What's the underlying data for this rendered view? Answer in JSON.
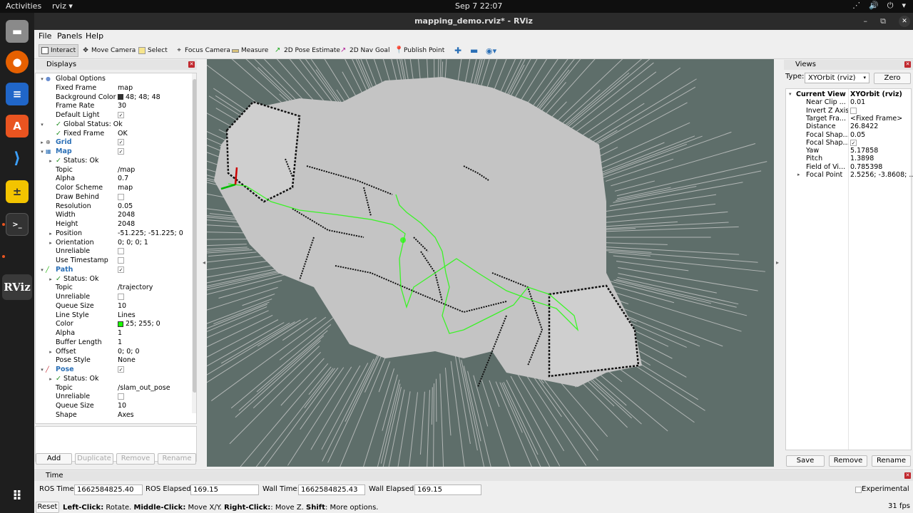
{
  "system": {
    "activities": "Activities",
    "app_name": "rviz ▾",
    "clock": "Sep 7  22:07",
    "tray": [
      "⋰",
      "🔊",
      "⏻",
      "▾"
    ]
  },
  "window": {
    "title": "mapping_demo.rviz* - RViz",
    "controls": [
      "–",
      "⧉",
      "✕"
    ]
  },
  "menu": [
    "File",
    "Panels",
    "Help"
  ],
  "toolbar": [
    {
      "label": "Interact",
      "icon": "interact-icon"
    },
    {
      "label": "Move Camera",
      "icon": "move-camera-icon"
    },
    {
      "label": "Select",
      "icon": "select-icon"
    },
    {
      "label": "Focus Camera",
      "icon": "focus-camera-icon"
    },
    {
      "label": "Measure",
      "icon": "measure-icon"
    },
    {
      "label": "2D Pose Estimate",
      "icon": "pose-estimate-icon"
    },
    {
      "label": "2D Nav Goal",
      "icon": "nav-goal-icon"
    },
    {
      "label": "Publish Point",
      "icon": "publish-point-icon"
    }
  ],
  "displays": {
    "title": "Displays",
    "rows": [
      {
        "d": 0,
        "exp": "▾",
        "label": "Global Options",
        "value": "",
        "type": "group"
      },
      {
        "d": 1,
        "exp": "",
        "label": "Fixed Frame",
        "value": "map"
      },
      {
        "d": 1,
        "exp": "",
        "label": "Background Color",
        "value": "48; 48; 48",
        "swatch": "#303030"
      },
      {
        "d": 1,
        "exp": "",
        "label": "Frame Rate",
        "value": "30"
      },
      {
        "d": 1,
        "exp": "",
        "label": "Default Light",
        "value": "",
        "chk": true
      },
      {
        "d": 0,
        "exp": "▾",
        "label": "Global Status: Ok",
        "value": "",
        "check": true
      },
      {
        "d": 1,
        "exp": "",
        "label": "Fixed Frame",
        "value": "OK",
        "check": true
      },
      {
        "d": 0,
        "exp": "▸",
        "label": "Grid",
        "value": "",
        "chk": true,
        "blue": true
      },
      {
        "d": 0,
        "exp": "▾",
        "label": "Map",
        "value": "",
        "chk": true,
        "blue": true
      },
      {
        "d": 1,
        "exp": "▸",
        "label": "Status: Ok",
        "value": "",
        "check": true
      },
      {
        "d": 1,
        "exp": "",
        "label": "Topic",
        "value": "/map"
      },
      {
        "d": 1,
        "exp": "",
        "label": "Alpha",
        "value": "0.7"
      },
      {
        "d": 1,
        "exp": "",
        "label": "Color Scheme",
        "value": "map"
      },
      {
        "d": 1,
        "exp": "",
        "label": "Draw Behind",
        "value": "",
        "chk": false
      },
      {
        "d": 1,
        "exp": "",
        "label": "Resolution",
        "value": "0.05"
      },
      {
        "d": 1,
        "exp": "",
        "label": "Width",
        "value": "2048"
      },
      {
        "d": 1,
        "exp": "",
        "label": "Height",
        "value": "2048"
      },
      {
        "d": 1,
        "exp": "▸",
        "label": "Position",
        "value": "-51.225; -51.225; 0"
      },
      {
        "d": 1,
        "exp": "▸",
        "label": "Orientation",
        "value": "0; 0; 0; 1"
      },
      {
        "d": 1,
        "exp": "",
        "label": "Unreliable",
        "value": "",
        "chk": false
      },
      {
        "d": 1,
        "exp": "",
        "label": "Use Timestamp",
        "value": "",
        "chk": false
      },
      {
        "d": 0,
        "exp": "▾",
        "label": "Path",
        "value": "",
        "chk": true,
        "blue": true
      },
      {
        "d": 1,
        "exp": "▸",
        "label": "Status: Ok",
        "value": "",
        "check": true
      },
      {
        "d": 1,
        "exp": "",
        "label": "Topic",
        "value": "/trajectory"
      },
      {
        "d": 1,
        "exp": "",
        "label": "Unreliable",
        "value": "",
        "chk": false
      },
      {
        "d": 1,
        "exp": "",
        "label": "Queue Size",
        "value": "10"
      },
      {
        "d": 1,
        "exp": "",
        "label": "Line Style",
        "value": "Lines"
      },
      {
        "d": 1,
        "exp": "",
        "label": "Color",
        "value": "25; 255; 0",
        "swatch": "#19ff00"
      },
      {
        "d": 1,
        "exp": "",
        "label": "Alpha",
        "value": "1"
      },
      {
        "d": 1,
        "exp": "",
        "label": "Buffer Length",
        "value": "1"
      },
      {
        "d": 1,
        "exp": "▸",
        "label": "Offset",
        "value": "0; 0; 0"
      },
      {
        "d": 1,
        "exp": "",
        "label": "Pose Style",
        "value": "None"
      },
      {
        "d": 0,
        "exp": "▾",
        "label": "Pose",
        "value": "",
        "chk": true,
        "blue": true
      },
      {
        "d": 1,
        "exp": "▸",
        "label": "Status: Ok",
        "value": "",
        "check": true
      },
      {
        "d": 1,
        "exp": "",
        "label": "Topic",
        "value": "/slam_out_pose"
      },
      {
        "d": 1,
        "exp": "",
        "label": "Unreliable",
        "value": "",
        "chk": false
      },
      {
        "d": 1,
        "exp": "",
        "label": "Queue Size",
        "value": "10"
      },
      {
        "d": 1,
        "exp": "",
        "label": "Shape",
        "value": "Axes"
      }
    ],
    "buttons": {
      "add": "Add",
      "duplicate": "Duplicate",
      "remove": "Remove",
      "rename": "Rename"
    }
  },
  "views": {
    "title": "Views",
    "type_label": "Type:",
    "type_value": "XYOrbit (rviz)",
    "zero_label": "Zero",
    "rows": [
      {
        "exp": "▾",
        "label": "Current View",
        "value": "XYOrbit (rviz)",
        "bold": true
      },
      {
        "exp": "",
        "label": "Near Clip ...",
        "value": "0.01"
      },
      {
        "exp": "",
        "label": "Invert Z Axis",
        "value": "",
        "chk": false
      },
      {
        "exp": "",
        "label": "Target Fra...",
        "value": "<Fixed Frame>"
      },
      {
        "exp": "",
        "label": "Distance",
        "value": "26.8422"
      },
      {
        "exp": "",
        "label": "Focal Shap...",
        "value": "0.05"
      },
      {
        "exp": "",
        "label": "Focal Shap...",
        "value": "",
        "chk": true
      },
      {
        "exp": "",
        "label": "Yaw",
        "value": "5.17858"
      },
      {
        "exp": "",
        "label": "Pitch",
        "value": "1.3898"
      },
      {
        "exp": "",
        "label": "Field of Vi...",
        "value": "0.785398"
      },
      {
        "exp": "▸",
        "label": "Focal Point",
        "value": "2.5256; -3.8608; ..."
      }
    ],
    "buttons": {
      "save": "Save",
      "remove": "Remove",
      "rename": "Rename"
    }
  },
  "time": {
    "title": "Time",
    "ros_time_label": "ROS Time:",
    "ros_time": "1662584825.40",
    "ros_elapsed_label": "ROS Elapsed:",
    "ros_elapsed": "169.15",
    "wall_time_label": "Wall Time:",
    "wall_time": "1662584825.43",
    "wall_elapsed_label": "Wall Elapsed:",
    "wall_elapsed": "169.15",
    "experimental_label": "Experimental",
    "reset_label": "Reset",
    "hint": {
      "b1": "Left-Click:",
      "t1": " Rotate. ",
      "b2": "Middle-Click:",
      "t2": " Move X/Y. ",
      "b3": "Right-Click:",
      "t3": ": Move Z. ",
      "b4": "Shift",
      "t4": ": More options."
    },
    "fps": "31 fps"
  },
  "colors": {
    "viewport_bg": "#5e6e6a",
    "map_free": "#c4c4c4",
    "path": "#19ff00",
    "accent_blue": "#2a6fb6"
  }
}
